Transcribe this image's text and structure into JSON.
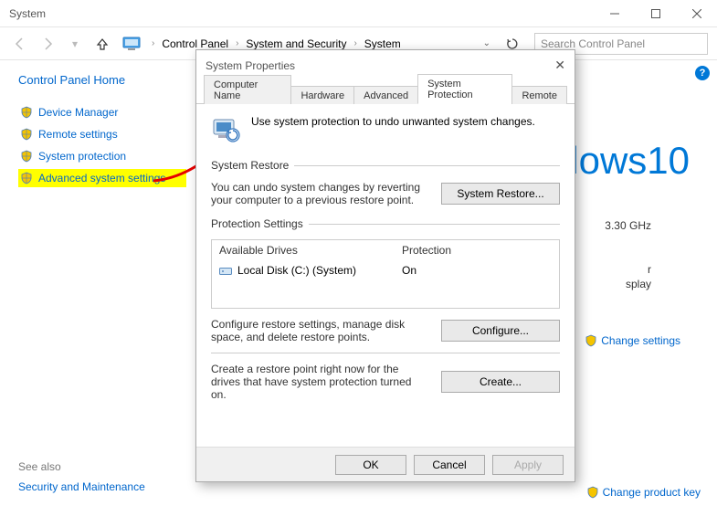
{
  "window": {
    "title": "System"
  },
  "breadcrumb": {
    "a": "Control Panel",
    "b": "System and Security",
    "c": "System"
  },
  "search": {
    "placeholder": "Search Control Panel"
  },
  "sidebar": {
    "home": "Control Panel Home",
    "items": [
      {
        "label": "Device Manager"
      },
      {
        "label": "Remote settings"
      },
      {
        "label": "System protection"
      },
      {
        "label": "Advanced system settings"
      }
    ],
    "see_also": "See also",
    "sec_maint": "Security and Maintenance"
  },
  "right": {
    "brand": "dows10",
    "spec1": "3.30 GHz",
    "spec2": "r",
    "spec3": "splay",
    "change_settings": "Change settings",
    "change_product": "Change product key"
  },
  "dialog": {
    "title": "System Properties",
    "tabs": {
      "a": "Computer Name",
      "b": "Hardware",
      "c": "Advanced",
      "d": "System Protection",
      "e": "Remote"
    },
    "intro": "Use system protection to undo unwanted system changes.",
    "restore": {
      "legend": "System Restore",
      "desc": "You can undo system changes by reverting your computer to a previous restore point.",
      "btn": "System Restore..."
    },
    "prot": {
      "legend": "Protection Settings",
      "col1": "Available Drives",
      "col2": "Protection",
      "drive": "Local Disk (C:) (System)",
      "status": "On",
      "cfg_desc": "Configure restore settings, manage disk space, and delete restore points.",
      "cfg_btn": "Configure...",
      "create_desc": "Create a restore point right now for the drives that have system protection turned on.",
      "create_btn": "Create..."
    },
    "footer": {
      "ok": "OK",
      "cancel": "Cancel",
      "apply": "Apply"
    }
  }
}
